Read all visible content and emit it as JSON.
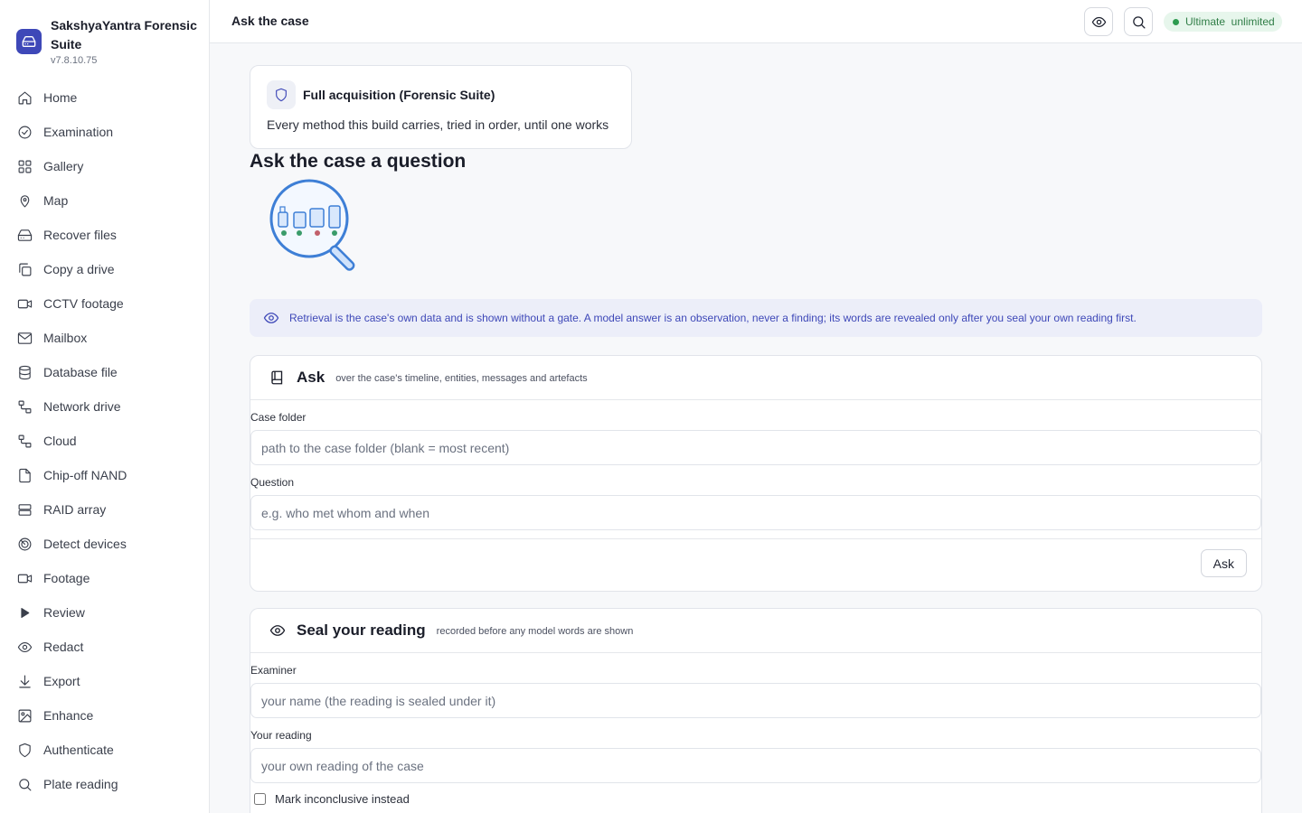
{
  "brand": {
    "name": "SakshyaYantra Forensic Suite",
    "version": "v7.8.10.75"
  },
  "nav": [
    {
      "label": "Home",
      "icon": "home-icon"
    },
    {
      "label": "Examination",
      "icon": "check-circle-icon"
    },
    {
      "label": "Gallery",
      "icon": "grid-icon"
    },
    {
      "label": "Map",
      "icon": "map-pin-icon"
    },
    {
      "label": "Recover files",
      "icon": "hard-drive-icon"
    },
    {
      "label": "Copy a drive",
      "icon": "copy-icon"
    },
    {
      "label": "CCTV footage",
      "icon": "video-icon"
    },
    {
      "label": "Mailbox",
      "icon": "mail-icon"
    },
    {
      "label": "Database file",
      "icon": "database-icon"
    },
    {
      "label": "Network drive",
      "icon": "network-icon"
    },
    {
      "label": "Cloud",
      "icon": "cloud-network-icon"
    },
    {
      "label": "Chip-off NAND",
      "icon": "file-icon"
    },
    {
      "label": "RAID array",
      "icon": "server-icon"
    },
    {
      "label": "Detect devices",
      "icon": "radar-icon"
    },
    {
      "label": "Footage",
      "icon": "video-icon"
    },
    {
      "label": "Review",
      "icon": "play-icon"
    },
    {
      "label": "Redact",
      "icon": "eye-icon"
    },
    {
      "label": "Export",
      "icon": "download-icon"
    },
    {
      "label": "Enhance",
      "icon": "image-icon"
    },
    {
      "label": "Authenticate",
      "icon": "shield-icon"
    },
    {
      "label": "Plate reading",
      "icon": "search-icon"
    }
  ],
  "topbar": {
    "title": "Ask the case",
    "tier_label": "Ultimate  unlimited"
  },
  "mode": {
    "title": "Full acquisition (Forensic Suite)",
    "description": "Every method this build carries, tried in order, until one works"
  },
  "page_heading": "Ask the case a question",
  "notice": "Retrieval is the case's own data and is shown without a gate. A model answer is an observation, never a finding; its words are revealed only after you seal your own reading first.",
  "ask_card": {
    "title": "Ask",
    "subtitle": "over the case's timeline, entities, messages and artefacts",
    "case_folder_label": "Case folder",
    "case_folder_placeholder": "path to the case folder (blank = most recent)",
    "case_folder_value": "",
    "question_label": "Question",
    "question_placeholder": "e.g. who met whom and when",
    "question_value": "",
    "ask_button": "Ask"
  },
  "seal_card": {
    "title": "Seal your reading",
    "subtitle": "recorded before any model words are shown",
    "examiner_label": "Examiner",
    "examiner_placeholder": "your name (the reading is sealed under it)",
    "examiner_value": "",
    "reading_label": "Your reading",
    "reading_placeholder": "your own reading of the case",
    "reading_value": "",
    "inconclusive_label": "Mark inconclusive instead",
    "inconclusive_checked": false
  },
  "colors": {
    "accent": "#3e48b8",
    "notice_bg": "#eceef9",
    "badge_bg": "#e7f6ec",
    "badge_text": "#2f7d46"
  }
}
